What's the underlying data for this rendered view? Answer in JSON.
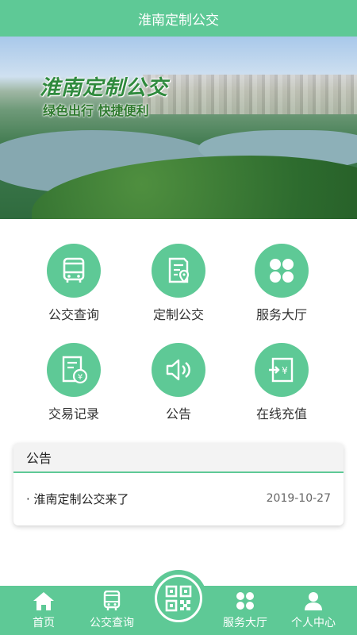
{
  "header": {
    "title": "淮南定制公交"
  },
  "banner": {
    "title": "淮南定制公交",
    "slogan": "绿色出行 快捷便利",
    "dots": 3,
    "active_dot": 0
  },
  "grid": [
    {
      "label": "公交查询",
      "icon": "bus-icon"
    },
    {
      "label": "定制公交",
      "icon": "document-location-icon"
    },
    {
      "label": "服务大厅",
      "icon": "four-dots-icon"
    },
    {
      "label": "交易记录",
      "icon": "receipt-yuan-icon"
    },
    {
      "label": "公告",
      "icon": "speaker-icon"
    },
    {
      "label": "在线充值",
      "icon": "recharge-yuan-icon"
    }
  ],
  "notice": {
    "heading": "公告",
    "items": [
      {
        "title": "淮南定制公交来了",
        "date": "2019-10-27"
      }
    ]
  },
  "tabbar": {
    "items": [
      {
        "label": "首页",
        "icon": "home-icon"
      },
      {
        "label": "公交查询",
        "icon": "bus-icon"
      },
      {
        "label": "",
        "icon": "qr-code-icon"
      },
      {
        "label": "服务大厅",
        "icon": "four-dots-icon"
      },
      {
        "label": "个人中心",
        "icon": "person-icon"
      }
    ]
  },
  "colors": {
    "primary": "#5ec996",
    "active_dot": "#25a86a"
  }
}
